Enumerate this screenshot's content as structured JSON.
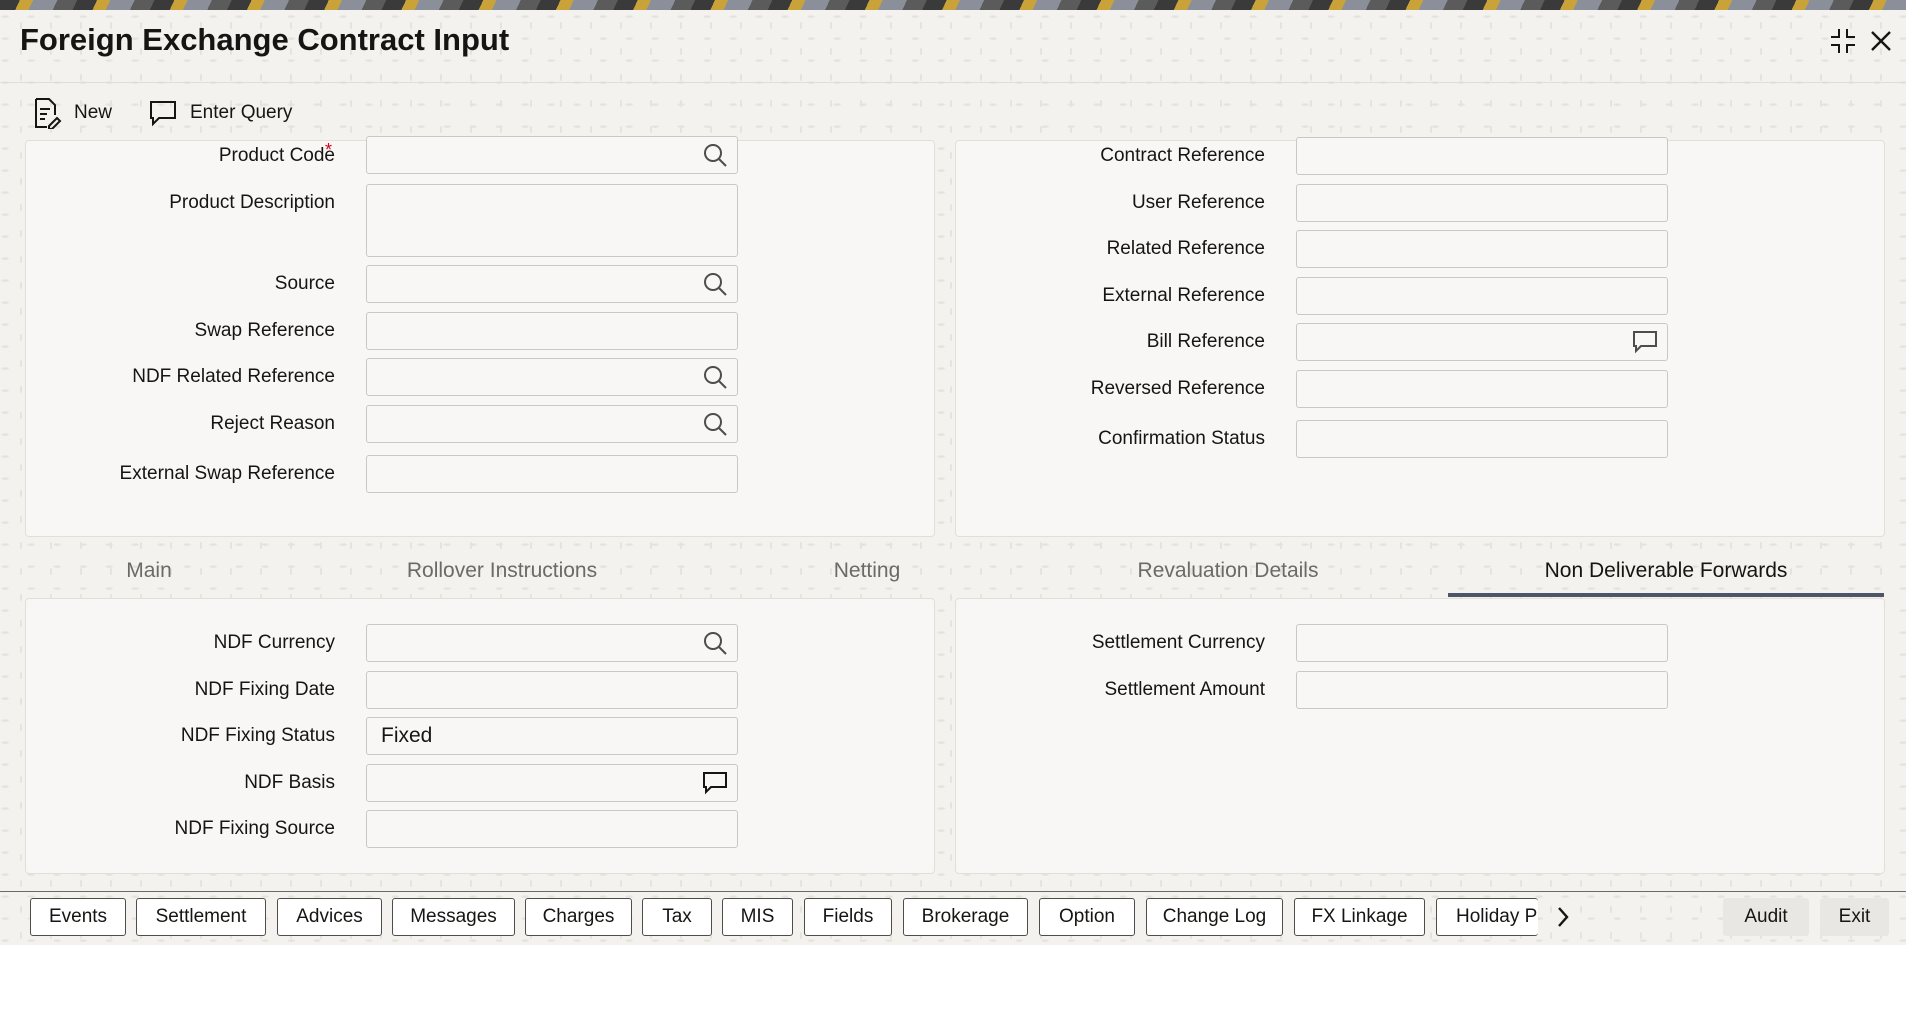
{
  "window": {
    "title": "Foreign Exchange Contract Input"
  },
  "toolbar": {
    "new_label": "New",
    "enter_query_label": "Enter Query"
  },
  "left_fields": {
    "product_code": "Product Code",
    "product_description": "Product Description",
    "source": "Source",
    "swap_reference": "Swap Reference",
    "ndf_related_reference": "NDF Related Reference",
    "reject_reason": "Reject Reason",
    "external_swap_reference": "External Swap Reference",
    "required_mark": "*"
  },
  "right_fields": {
    "contract_reference": "Contract Reference",
    "user_reference": "User Reference",
    "related_reference": "Related Reference",
    "external_reference": "External Reference",
    "bill_reference": "Bill Reference",
    "reversed_reference": "Reversed Reference",
    "confirmation_status": "Confirmation Status"
  },
  "tabs": [
    {
      "label": "Main"
    },
    {
      "label": "Rollover Instructions"
    },
    {
      "label": "Netting"
    },
    {
      "label": "Revaluation Details"
    },
    {
      "label": "Non Deliverable Forwards"
    }
  ],
  "ndf": {
    "ndf_currency": "NDF Currency",
    "ndf_fixing_date": "NDF Fixing Date",
    "ndf_fixing_status": "NDF Fixing Status",
    "ndf_fixing_status_value": "Fixed",
    "ndf_basis": "NDF Basis",
    "ndf_fixing_source": "NDF Fixing Source",
    "settlement_currency": "Settlement Currency",
    "settlement_amount": "Settlement Amount"
  },
  "footer": {
    "buttons": [
      "Events",
      "Settlement",
      "Advices",
      "Messages",
      "Charges",
      "Tax",
      "MIS",
      "Fields",
      "Brokerage",
      "Option",
      "Change Log",
      "FX Linkage",
      "Holiday Pr"
    ],
    "audit_label": "Audit",
    "exit_label": "Exit"
  }
}
